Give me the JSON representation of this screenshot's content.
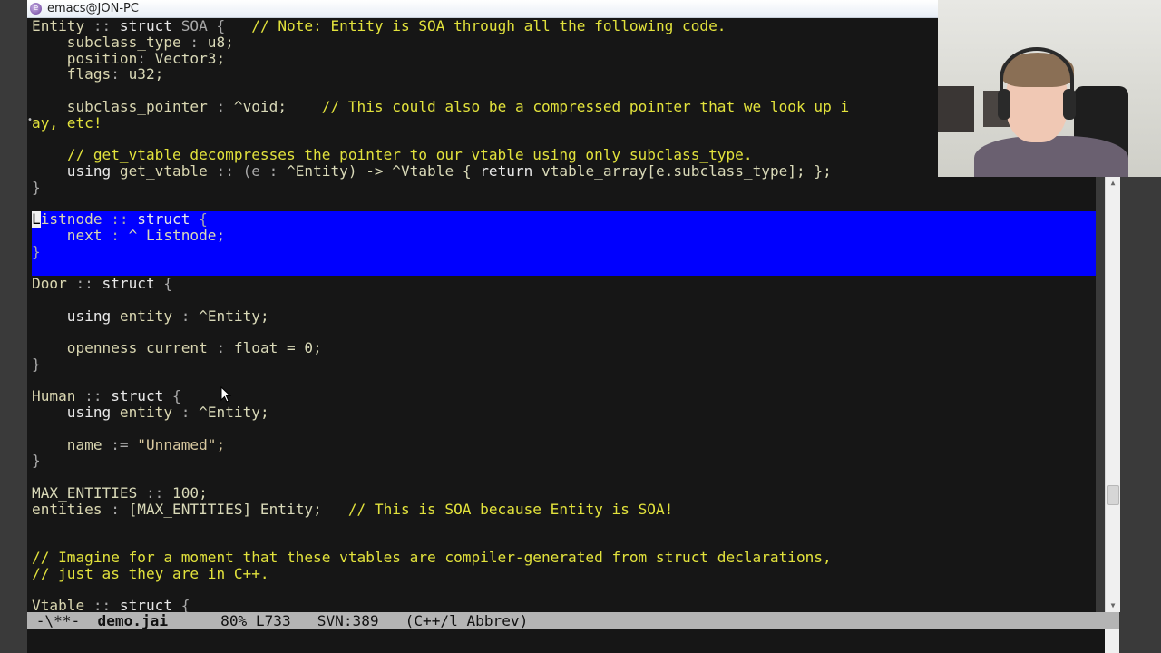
{
  "window": {
    "title": "emacs@JON-PC"
  },
  "code_top": [
    [
      {
        "t": "Entity",
        "c": "c-id"
      },
      {
        "t": " :: ",
        "c": "c-punc"
      },
      {
        "t": "struct",
        "c": "c-kw"
      },
      {
        "t": " SOA {   ",
        "c": "c-punc"
      },
      {
        "t": "// Note: Entity is SOA through all the following code.",
        "c": "c-cmt"
      }
    ],
    [
      {
        "t": "    subclass_type",
        "c": "c-id"
      },
      {
        "t": " : ",
        "c": "c-punc"
      },
      {
        "t": "u8;",
        "c": "c-type"
      }
    ],
    [
      {
        "t": "    position",
        "c": "c-id"
      },
      {
        "t": ": ",
        "c": "c-punc"
      },
      {
        "t": "Vector3;",
        "c": "c-type"
      }
    ],
    [
      {
        "t": "    flags",
        "c": "c-id"
      },
      {
        "t": ": ",
        "c": "c-punc"
      },
      {
        "t": "u32;",
        "c": "c-type"
      }
    ],
    [
      {
        "t": "",
        "c": "c-punc"
      }
    ],
    [
      {
        "t": "    subclass_pointer",
        "c": "c-id"
      },
      {
        "t": " : ",
        "c": "c-punc"
      },
      {
        "t": "^void;    ",
        "c": "c-type"
      },
      {
        "t": "// This could also be a compressed pointer that we look up i",
        "c": "c-cmt"
      }
    ],
    [
      {
        "t": "ay, etc!",
        "c": "c-cmt"
      }
    ],
    [
      {
        "t": "",
        "c": "c-punc"
      }
    ],
    [
      {
        "t": "    // get_vtable decompresses the pointer to our vtable using only subclass_type.",
        "c": "c-cmt"
      }
    ],
    [
      {
        "t": "    using ",
        "c": "c-kw"
      },
      {
        "t": "get_vtable",
        "c": "c-id"
      },
      {
        "t": " :: (e : ",
        "c": "c-punc"
      },
      {
        "t": "^Entity) -> ^Vtable { ",
        "c": "c-type"
      },
      {
        "t": "return ",
        "c": "c-kw"
      },
      {
        "t": "vtable_array[e.subclass_type]; };",
        "c": "c-type"
      }
    ],
    [
      {
        "t": "}",
        "c": "c-punc"
      }
    ],
    [
      {
        "t": "",
        "c": "c-punc"
      }
    ]
  ],
  "code_selected": [
    [
      {
        "t": "istnode",
        "c": "c-id"
      },
      {
        "t": " :: ",
        "c": "c-punc"
      },
      {
        "t": "struct",
        "c": "c-kw"
      },
      {
        "t": " {",
        "c": "c-punc"
      }
    ],
    [
      {
        "t": "    next",
        "c": "c-id"
      },
      {
        "t": " : ",
        "c": "c-punc"
      },
      {
        "t": "^ Listnode;",
        "c": "c-type"
      }
    ],
    [
      {
        "t": "}",
        "c": "c-punc"
      }
    ]
  ],
  "cursor_char": "L",
  "code_bottom": [
    [
      {
        "t": "Door",
        "c": "c-id"
      },
      {
        "t": " :: ",
        "c": "c-punc"
      },
      {
        "t": "struct",
        "c": "c-kw"
      },
      {
        "t": " {",
        "c": "c-punc"
      }
    ],
    [
      {
        "t": "",
        "c": "c-punc"
      }
    ],
    [
      {
        "t": "    using ",
        "c": "c-kw"
      },
      {
        "t": "entity",
        "c": "c-id"
      },
      {
        "t": " : ",
        "c": "c-punc"
      },
      {
        "t": "^Entity;",
        "c": "c-type"
      }
    ],
    [
      {
        "t": "",
        "c": "c-punc"
      }
    ],
    [
      {
        "t": "    openness_current",
        "c": "c-id"
      },
      {
        "t": " : ",
        "c": "c-punc"
      },
      {
        "t": "float = 0;",
        "c": "c-type"
      }
    ],
    [
      {
        "t": "}",
        "c": "c-punc"
      }
    ],
    [
      {
        "t": "",
        "c": "c-punc"
      }
    ],
    [
      {
        "t": "Human",
        "c": "c-id"
      },
      {
        "t": " :: ",
        "c": "c-punc"
      },
      {
        "t": "struct",
        "c": "c-kw"
      },
      {
        "t": " {",
        "c": "c-punc"
      }
    ],
    [
      {
        "t": "    using ",
        "c": "c-kw"
      },
      {
        "t": "entity",
        "c": "c-id"
      },
      {
        "t": " : ",
        "c": "c-punc"
      },
      {
        "t": "^Entity;",
        "c": "c-type"
      }
    ],
    [
      {
        "t": "",
        "c": "c-punc"
      }
    ],
    [
      {
        "t": "    name",
        "c": "c-id"
      },
      {
        "t": " := ",
        "c": "c-punc"
      },
      {
        "t": "\"Unnamed\";",
        "c": "c-str"
      }
    ],
    [
      {
        "t": "}",
        "c": "c-punc"
      }
    ],
    [
      {
        "t": "",
        "c": "c-punc"
      }
    ],
    [
      {
        "t": "MAX_ENTITIES",
        "c": "c-type"
      },
      {
        "t": " :: ",
        "c": "c-punc"
      },
      {
        "t": "100;",
        "c": "c-type"
      }
    ],
    [
      {
        "t": "entities",
        "c": "c-id"
      },
      {
        "t": " : ",
        "c": "c-punc"
      },
      {
        "t": "[MAX_ENTITIES] Entity;   ",
        "c": "c-type"
      },
      {
        "t": "// This is SOA because Entity is SOA!",
        "c": "c-cmt"
      }
    ],
    [
      {
        "t": "",
        "c": "c-punc"
      }
    ],
    [
      {
        "t": "",
        "c": "c-punc"
      }
    ],
    [
      {
        "t": "// Imagine for a moment that these vtables are compiler-generated from struct declarations,",
        "c": "c-cmt"
      }
    ],
    [
      {
        "t": "// just as they are in C++.",
        "c": "c-cmt"
      }
    ],
    [
      {
        "t": "",
        "c": "c-punc"
      }
    ],
    [
      {
        "t": "Vtable",
        "c": "c-id"
      },
      {
        "t": " :: ",
        "c": "c-punc"
      },
      {
        "t": "struct",
        "c": "c-kw"
      },
      {
        "t": " {",
        "c": "c-punc"
      }
    ]
  ],
  "modeline": {
    "status": " -\\**-  ",
    "buffer": "demo.jai",
    "position": "      80% L733   SVN:389   (C++/l Abbrev)"
  },
  "colors": {
    "selection": "#0000ff",
    "comment": "#e2e23c",
    "background": "#161616",
    "modeline": "#b4b4b4"
  },
  "icons": {
    "app": "emacs-icon",
    "pointer": "mouse-pointer-icon"
  }
}
